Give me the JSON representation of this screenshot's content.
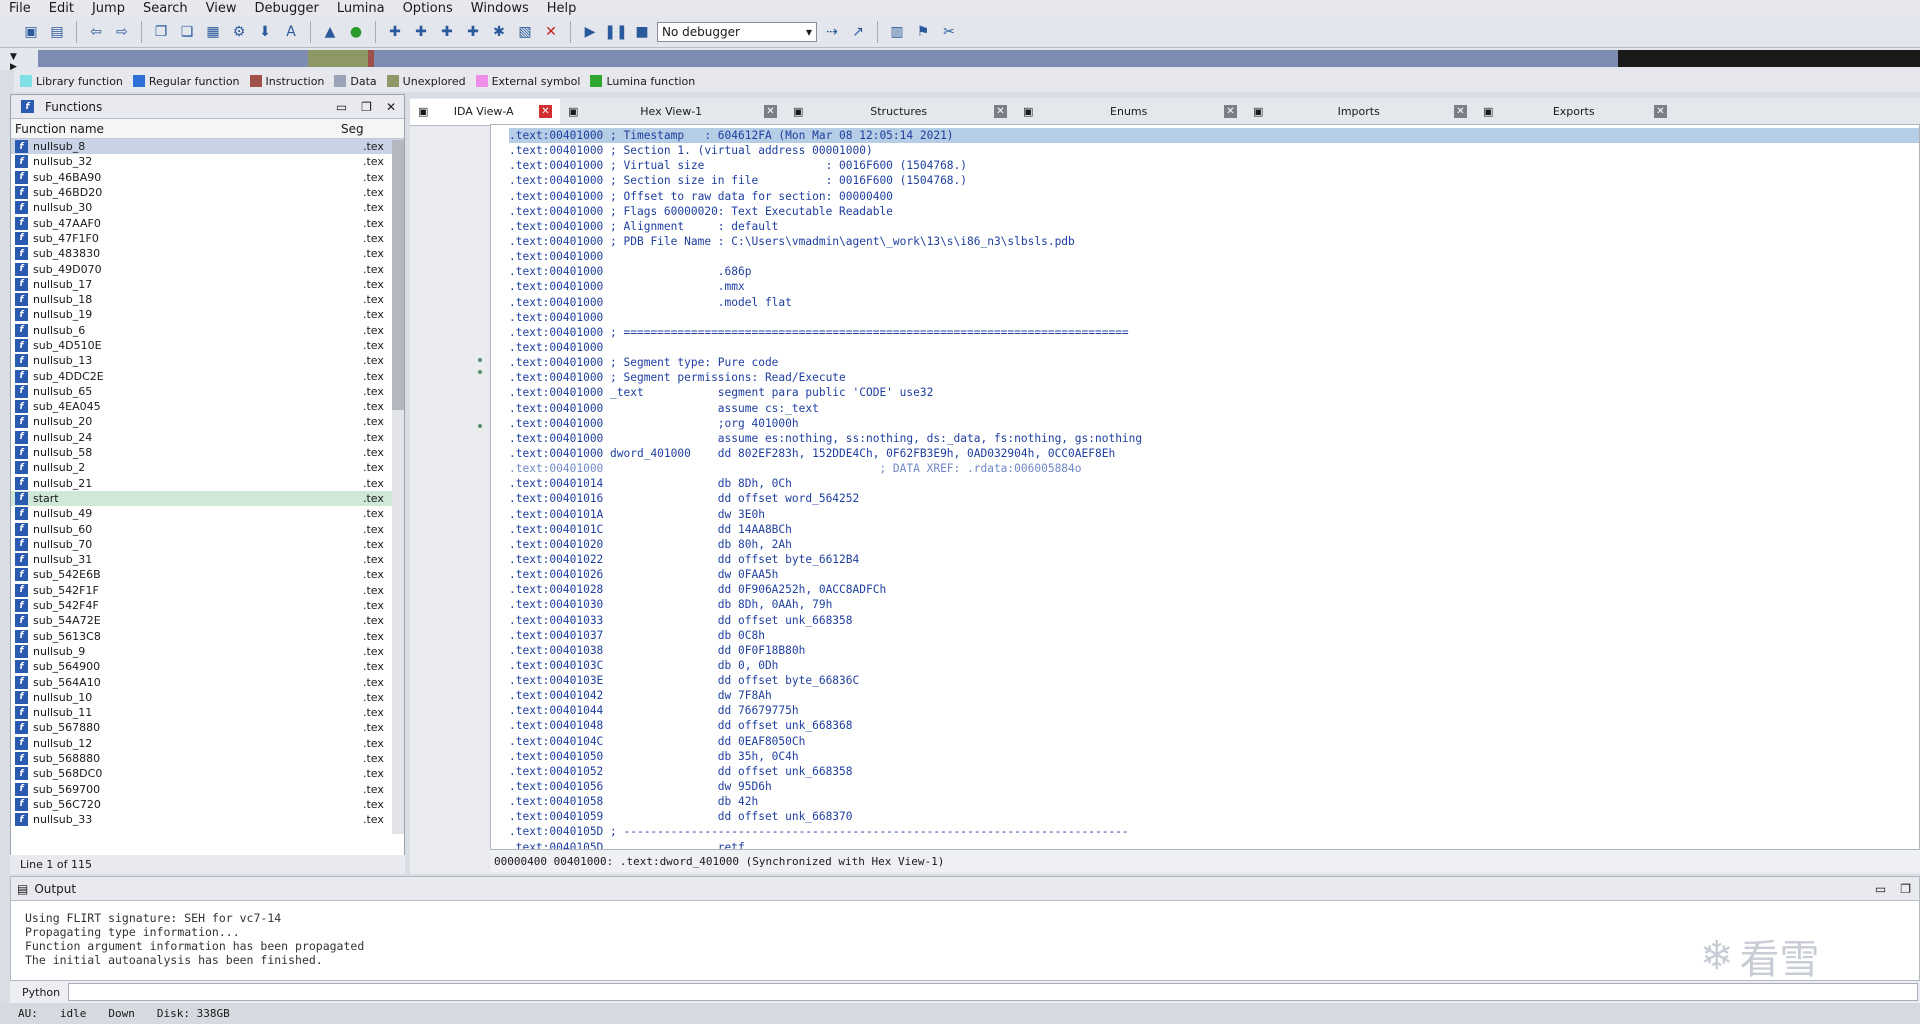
{
  "menu": [
    "File",
    "Edit",
    "Jump",
    "Search",
    "View",
    "Debugger",
    "Lumina",
    "Options",
    "Windows",
    "Help"
  ],
  "toolbar": {
    "debugger_value": "No debugger"
  },
  "legend": [
    {
      "label": "Library function",
      "color": "#7fe0e6"
    },
    {
      "label": "Regular function",
      "color": "#2e6fd6"
    },
    {
      "label": "Instruction",
      "color": "#a0504a"
    },
    {
      "label": "Data",
      "color": "#9aa3b8"
    },
    {
      "label": "Unexplored",
      "color": "#8e9766"
    },
    {
      "label": "External symbol",
      "color": "#ee8ee8"
    },
    {
      "label": "Lumina function",
      "color": "#2ea82e"
    }
  ],
  "functions_panel": {
    "title": "Functions",
    "col_name": "Function name",
    "col_seg": "Seg",
    "items": [
      {
        "name": "nullsub_8",
        "seg": ".tex"
      },
      {
        "name": "nullsub_32",
        "seg": ".tex"
      },
      {
        "name": "sub_46BA90",
        "seg": ".tex"
      },
      {
        "name": "sub_46BD20",
        "seg": ".tex"
      },
      {
        "name": "nullsub_30",
        "seg": ".tex"
      },
      {
        "name": "sub_47AAF0",
        "seg": ".tex"
      },
      {
        "name": "sub_47F1F0",
        "seg": ".tex"
      },
      {
        "name": "sub_483830",
        "seg": ".tex"
      },
      {
        "name": "sub_49D070",
        "seg": ".tex"
      },
      {
        "name": "nullsub_17",
        "seg": ".tex"
      },
      {
        "name": "nullsub_18",
        "seg": ".tex"
      },
      {
        "name": "nullsub_19",
        "seg": ".tex"
      },
      {
        "name": "nullsub_6",
        "seg": ".tex"
      },
      {
        "name": "sub_4D510E",
        "seg": ".tex"
      },
      {
        "name": "nullsub_13",
        "seg": ".tex"
      },
      {
        "name": "sub_4DDC2E",
        "seg": ".tex"
      },
      {
        "name": "nullsub_65",
        "seg": ".tex"
      },
      {
        "name": "sub_4EA045",
        "seg": ".tex"
      },
      {
        "name": "nullsub_20",
        "seg": ".tex"
      },
      {
        "name": "nullsub_24",
        "seg": ".tex"
      },
      {
        "name": "nullsub_58",
        "seg": ".tex"
      },
      {
        "name": "nullsub_2",
        "seg": ".tex"
      },
      {
        "name": "nullsub_21",
        "seg": ".tex"
      },
      {
        "name": "start",
        "seg": ".tex"
      },
      {
        "name": "nullsub_49",
        "seg": ".tex"
      },
      {
        "name": "nullsub_60",
        "seg": ".tex"
      },
      {
        "name": "nullsub_70",
        "seg": ".tex"
      },
      {
        "name": "nullsub_31",
        "seg": ".tex"
      },
      {
        "name": "sub_542E6B",
        "seg": ".tex"
      },
      {
        "name": "sub_542F1F",
        "seg": ".tex"
      },
      {
        "name": "sub_542F4F",
        "seg": ".tex"
      },
      {
        "name": "sub_54A72E",
        "seg": ".tex"
      },
      {
        "name": "sub_5613C8",
        "seg": ".tex"
      },
      {
        "name": "nullsub_9",
        "seg": ".tex"
      },
      {
        "name": "sub_564900",
        "seg": ".tex"
      },
      {
        "name": "sub_564A10",
        "seg": ".tex"
      },
      {
        "name": "nullsub_10",
        "seg": ".tex"
      },
      {
        "name": "nullsub_11",
        "seg": ".tex"
      },
      {
        "name": "sub_567880",
        "seg": ".tex"
      },
      {
        "name": "nullsub_12",
        "seg": ".tex"
      },
      {
        "name": "sub_568880",
        "seg": ".tex"
      },
      {
        "name": "sub_568DC0",
        "seg": ".tex"
      },
      {
        "name": "sub_569700",
        "seg": ".tex"
      },
      {
        "name": "sub_56C720",
        "seg": ".tex"
      },
      {
        "name": "nullsub_33",
        "seg": ".tex"
      }
    ],
    "footer": "Line 1 of 115"
  },
  "tabs": [
    {
      "label": "IDA View-A",
      "active": true
    },
    {
      "label": "Hex View-1"
    },
    {
      "label": "Structures"
    },
    {
      "label": "Enums"
    },
    {
      "label": "Imports"
    },
    {
      "label": "Exports"
    }
  ],
  "disasm_lines": [
    ".text:00401000 ; Timestamp   : 604612FA (Mon Mar 08 12:05:14 2021)",
    ".text:00401000 ; Section 1. (virtual address 00001000)",
    ".text:00401000 ; Virtual size                  : 0016F600 (1504768.)",
    ".text:00401000 ; Section size in file          : 0016F600 (1504768.)",
    ".text:00401000 ; Offset to raw data for section: 00000400",
    ".text:00401000 ; Flags 60000020: Text Executable Readable",
    ".text:00401000 ; Alignment     : default",
    ".text:00401000 ; PDB File Name : C:\\Users\\vmadmin\\agent\\_work\\13\\s\\i86_n3\\slbsls.pdb",
    ".text:00401000",
    ".text:00401000                 .686p",
    ".text:00401000                 .mmx",
    ".text:00401000                 .model flat",
    ".text:00401000",
    ".text:00401000 ; ===========================================================================",
    ".text:00401000",
    ".text:00401000 ; Segment type: Pure code",
    ".text:00401000 ; Segment permissions: Read/Execute",
    ".text:00401000 _text           segment para public 'CODE' use32",
    ".text:00401000                 assume cs:_text",
    ".text:00401000                 ;org 401000h",
    ".text:00401000                 assume es:nothing, ss:nothing, ds:_data, fs:nothing, gs:nothing",
    ".text:00401000 dword_401000    dd 802EF283h, 152DDE4Ch, 0F62FB3E9h, 0AD032904h, 0CC0AEF8Eh",
    ".text:00401000                                         ; DATA XREF: .rdata:006005884o",
    ".text:00401014                 db 8Dh, 0Ch",
    ".text:00401016                 dd offset word_564252",
    ".text:0040101A                 dw 3E0h",
    ".text:0040101C                 dd 14AA8BCh",
    ".text:00401020                 db 80h, 2Ah",
    ".text:00401022                 dd offset byte_6612B4",
    ".text:00401026                 dw 0FAA5h",
    ".text:00401028                 dd 0F906A252h, 0ACC8ADFCh",
    ".text:00401030                 db 8Dh, 0AAh, 79h",
    ".text:00401033                 dd offset unk_668358",
    ".text:00401037                 db 0C8h",
    ".text:00401038                 dd 0F0F18B80h",
    ".text:0040103C                 db 0, 0Dh",
    ".text:0040103E                 dd offset byte_66836C",
    ".text:00401042                 dw 7F8Ah",
    ".text:00401044                 dd 76679775h",
    ".text:00401048                 dd offset unk_668368",
    ".text:0040104C                 dd 0EAF8050Ch",
    ".text:00401050                 db 35h, 0C4h",
    ".text:00401052                 dd offset unk_668358",
    ".text:00401056                 dw 95D6h",
    ".text:00401058                 db 42h",
    ".text:00401059                 dd offset unk_668370",
    ".text:0040105D ; ---------------------------------------------------------------------------",
    ".text:0040105D                 retf"
  ],
  "sync_status": "00000400 00401000: .text:dword_401000 (Synchronized with Hex View-1)",
  "output": {
    "title": "Output",
    "lines": [
      "Using FLIRT signature: SEH for vc7-14",
      "Propagating type information...",
      "Function argument information has been propagated",
      "The initial autoanalysis has been finished."
    ],
    "python_label": "Python"
  },
  "statusbar": {
    "au": "AU:",
    "state": "idle",
    "direction": "Down",
    "disk": "Disk: 338GB"
  },
  "watermark": "看雪"
}
